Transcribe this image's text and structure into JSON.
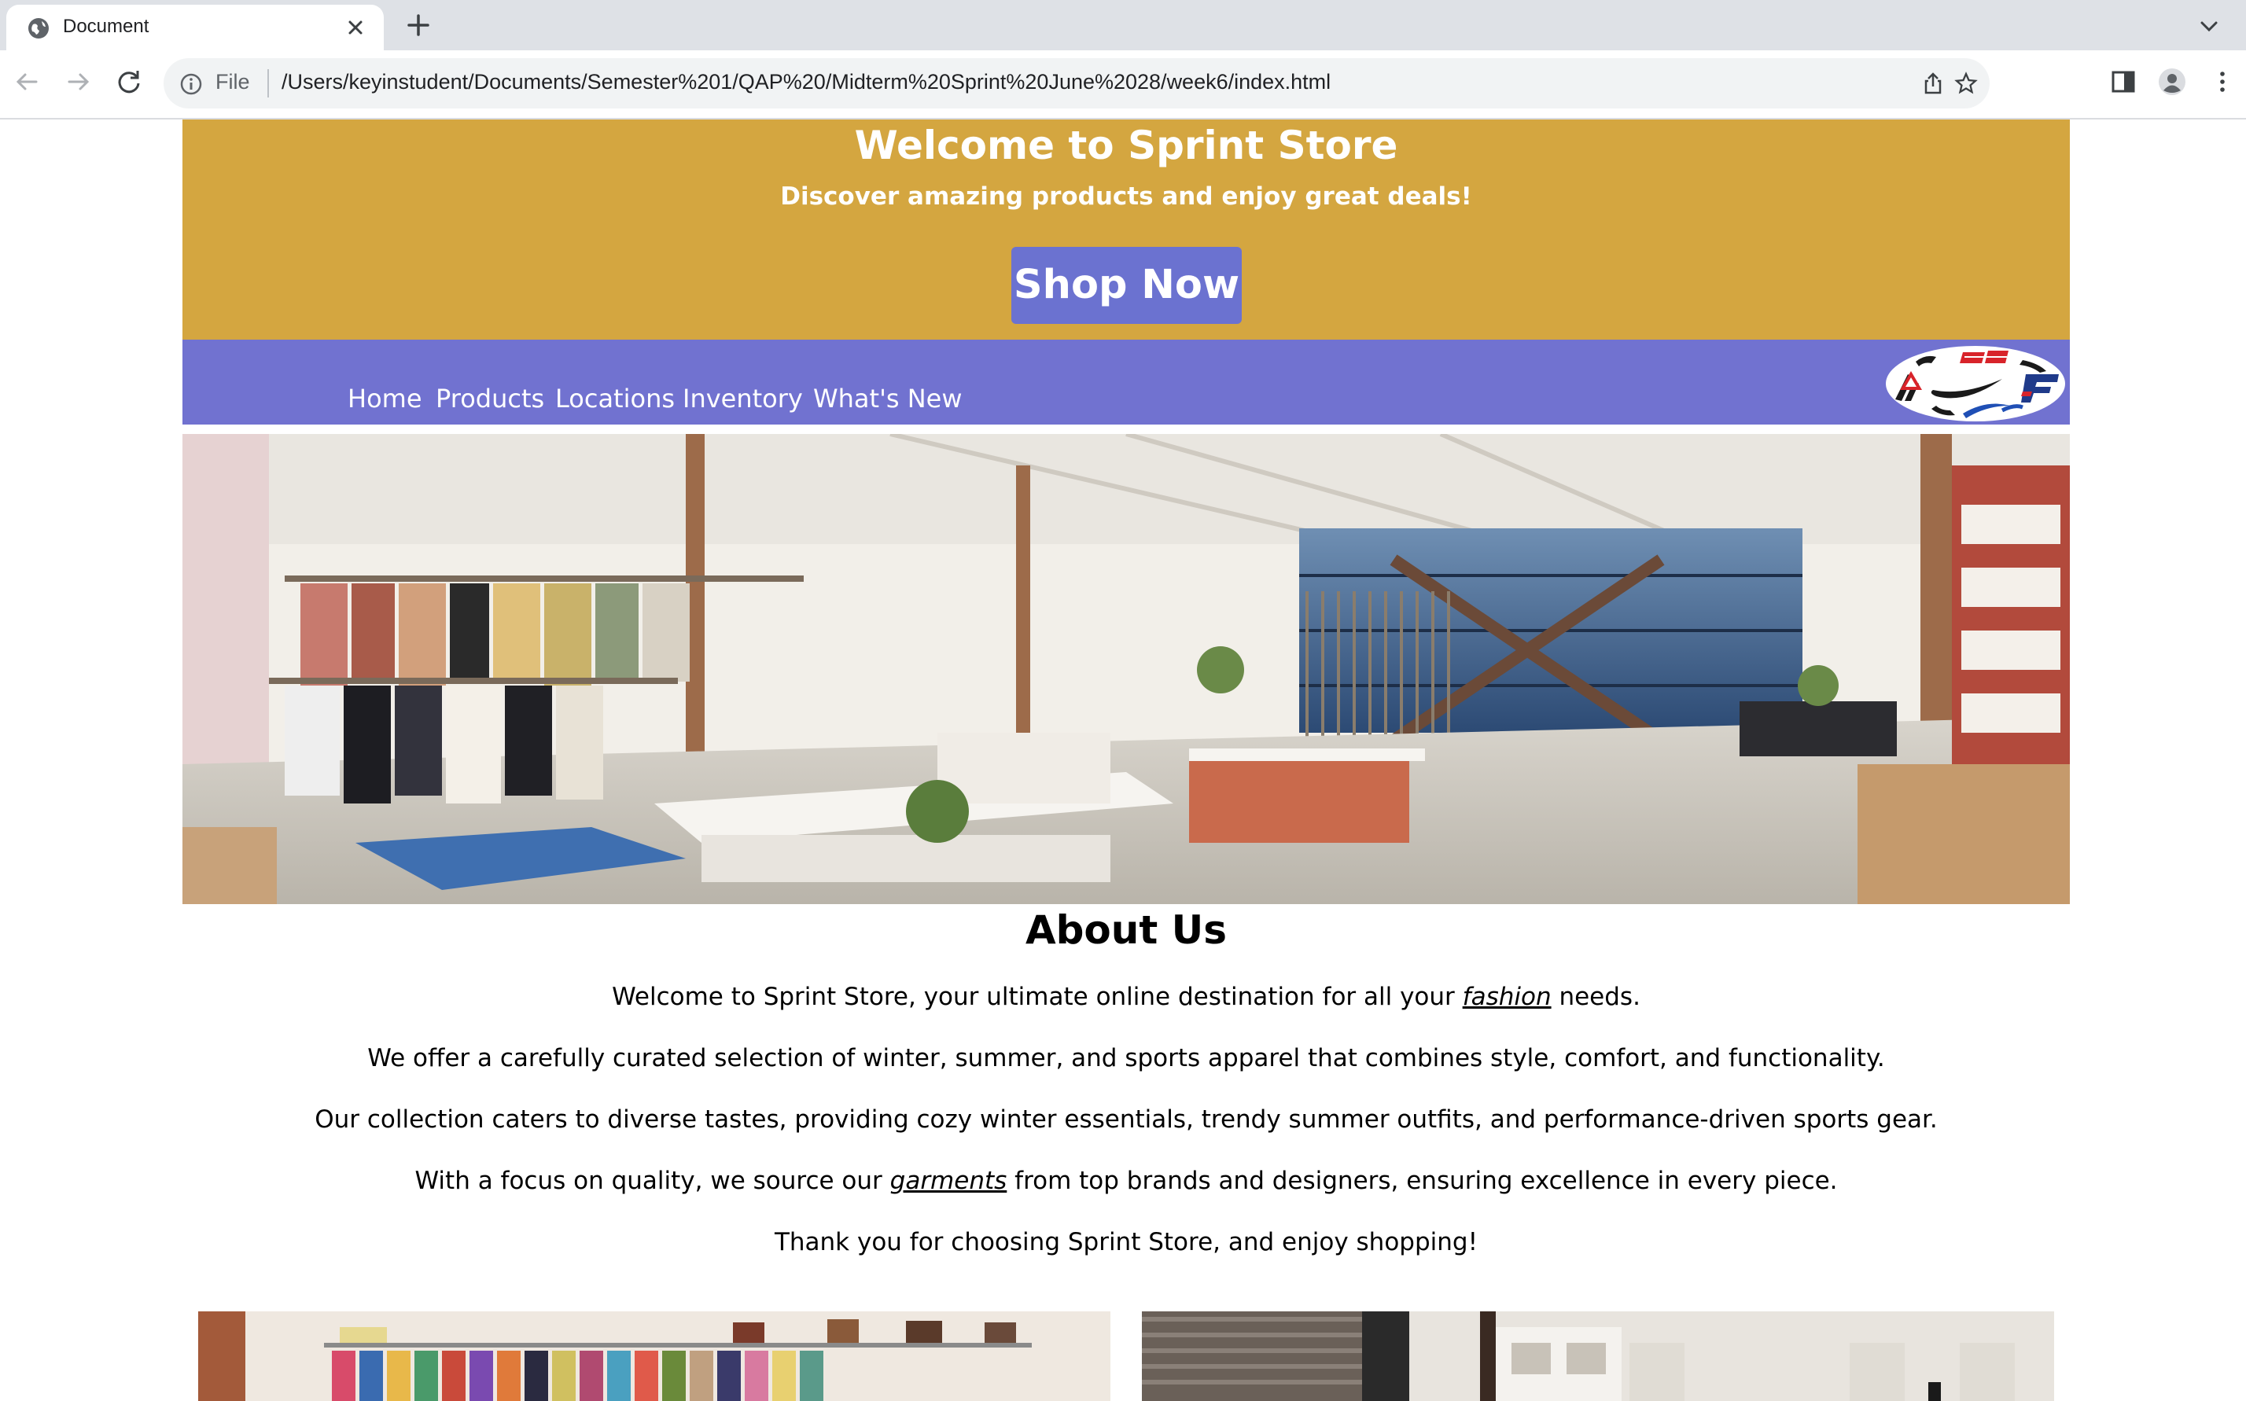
{
  "browser": {
    "tab_title": "Document",
    "omnibox_scheme": "File",
    "url": "/Users/keyinstudent/Documents/Semester%201/QAP%20/Midterm%20Sprint%20June%2028/week6/index.html"
  },
  "hero": {
    "title": "Welcome to Sprint Store",
    "subtitle": "Discover amazing products and enjoy great deals!",
    "cta_label": "Shop Now"
  },
  "nav": {
    "items": [
      {
        "label": "Home"
      },
      {
        "label": "Products"
      },
      {
        "label": "Locations"
      },
      {
        "label": "Inventory"
      },
      {
        "label": "What's New"
      }
    ]
  },
  "about": {
    "title": "About Us",
    "p1_before": "Welcome to Sprint Store, your ultimate online destination for all your ",
    "p1_link": "fashion",
    "p1_after": " needs.",
    "p2": "We offer a carefully curated selection of winter, summer, and sports apparel that combines style, comfort, and functionality.",
    "p3": "Our collection caters to diverse tastes, providing cozy winter essentials, trendy summer outfits, and performance-driven sports gear.",
    "p4_before": "With a focus on quality, we source our ",
    "p4_link": "garments",
    "p4_after": " from top brands and designers, ensuring excellence in every piece.",
    "p5": "Thank you for choosing Sprint Store, and enjoy shopping!"
  },
  "colors": {
    "banner": "#d4a640",
    "navbar": "#7172d0",
    "button": "#6b72d0"
  }
}
